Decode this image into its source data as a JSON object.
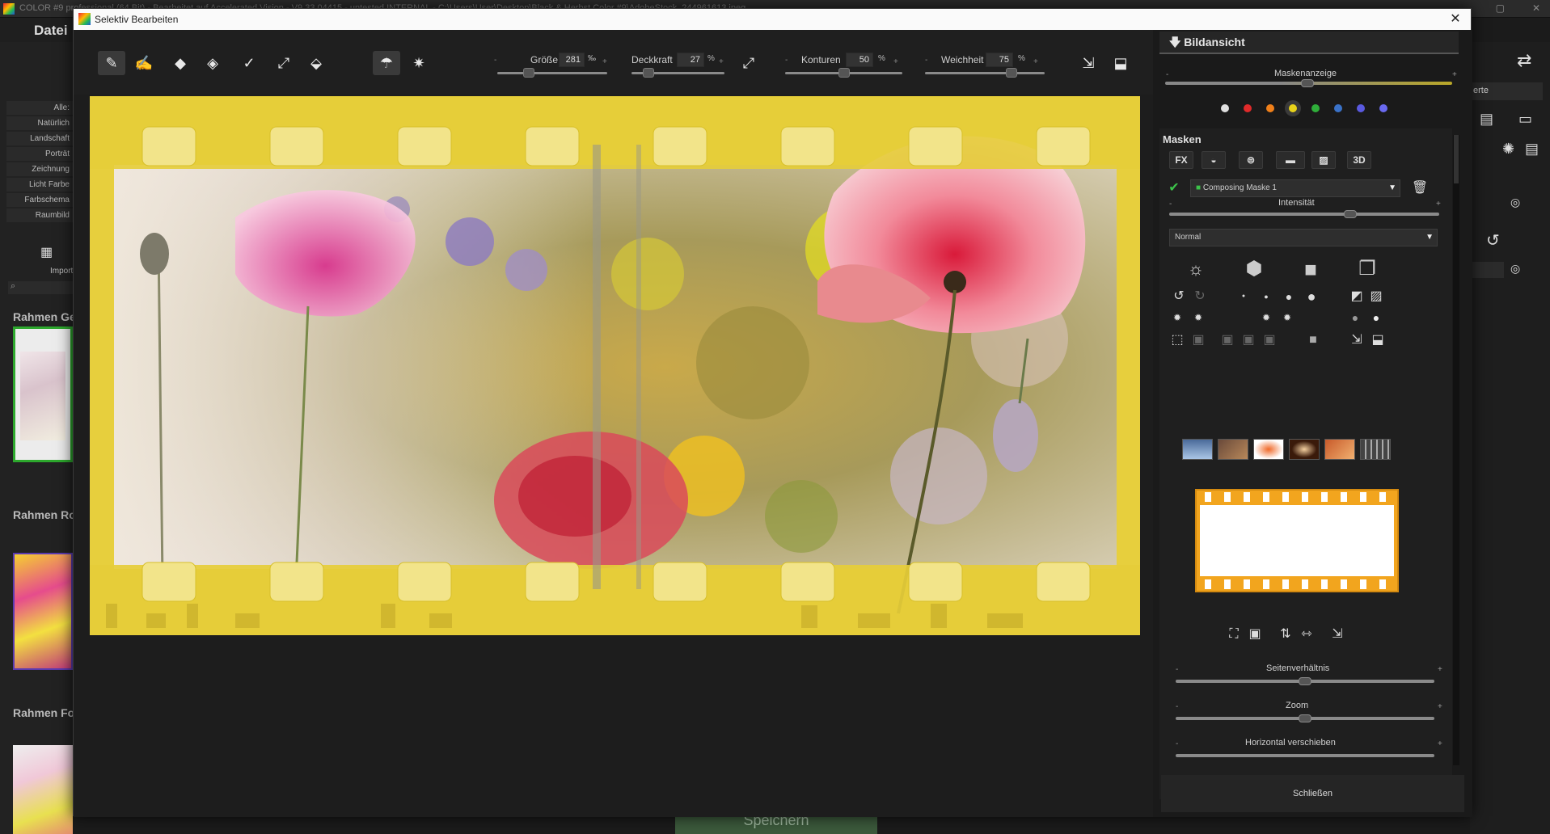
{
  "app": {
    "title": "COLOR #9 professional (64 Bit) - Bearbeitet auf Accelerated Vision - V9.33.04415 - untested INTERNAL - C:\\Users\\User\\Desktop\\Black & Herbst Color #9\\AdobeStock_244961613.jpeg",
    "menu_label": "Datei",
    "win_controls": [
      "—",
      "▢",
      "✕"
    ],
    "categories": [
      "Alle:",
      "Natürlich",
      "Landschaft",
      "Porträt",
      "Zeichnung",
      "Licht Farbe",
      "Farbschema",
      "Raumbild"
    ],
    "import_label": "Import",
    "sections": [
      "Rahmen Ge",
      "Rahmen Ro",
      "Rahmen Fo"
    ],
    "right_snippet": "erte",
    "save_label": "Speichern"
  },
  "dialog": {
    "title": "Selektiv Bearbeiten",
    "close_glyph": "✕",
    "toolbar": {
      "sliders": [
        {
          "label": "Größe",
          "value": "281",
          "unit": "‰"
        },
        {
          "label": "Deckkraft",
          "value": "27",
          "unit": "%"
        },
        {
          "label": "Konturen",
          "value": "50",
          "unit": "%"
        },
        {
          "label": "Weichheit",
          "value": "75",
          "unit": "%"
        }
      ],
      "minus": "-",
      "plus": "+"
    }
  },
  "panel": {
    "bildansicht_title": "Bildansicht",
    "maskenanzeige_label": "Maskenanzeige",
    "color_dots": [
      "#e0e0e0",
      "#e02a2a",
      "#f0801a",
      "#e8d21a",
      "#2fae3a",
      "#3a72c8",
      "#5a5ae0",
      "#6a6af0"
    ],
    "masken_title": "Masken",
    "mask_type_buttons": [
      "FX",
      "◒",
      "⊜",
      "▬",
      "▨",
      "3D"
    ],
    "mask_name": "Composing Maske 1",
    "intensitaet_label": "Intensität",
    "blend_mode": "Normal",
    "seitenverhaeltnis_label": "Seitenverhältnis",
    "zoom_label": "Zoom",
    "horizontal_label": "Horizontal verschieben",
    "close_label": "Schließen"
  }
}
